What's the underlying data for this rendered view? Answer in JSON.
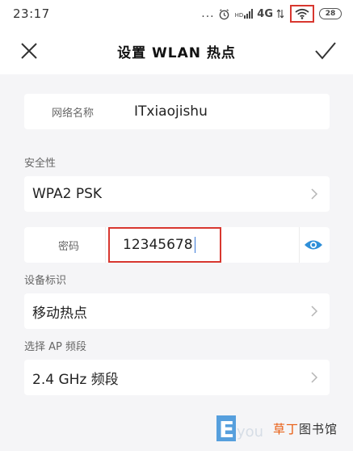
{
  "status_bar": {
    "time": "23:17",
    "dots": "...",
    "hd": "HD",
    "network": "4G",
    "battery": "28"
  },
  "header": {
    "title": "设置 WLAN 热点",
    "close_icon": "close-icon",
    "confirm_icon": "check-icon"
  },
  "ssid": {
    "label": "网络名称",
    "value": "ITxiaojishu"
  },
  "security": {
    "section_label": "安全性",
    "value": "WPA2 PSK"
  },
  "password": {
    "label": "密码",
    "value": "12345678",
    "toggle_icon": "eye-icon"
  },
  "device_id": {
    "section_label": "设备标识",
    "value": "移动热点"
  },
  "band": {
    "section_label": "选择 AP 频段",
    "value": "2.4 GHz 频段"
  },
  "watermark": {
    "accent_text": "草丁",
    "text": "图书馆"
  },
  "colors": {
    "highlight": "#d8372f",
    "accent": "#2f8fd8",
    "background": "#f5f5f7"
  }
}
